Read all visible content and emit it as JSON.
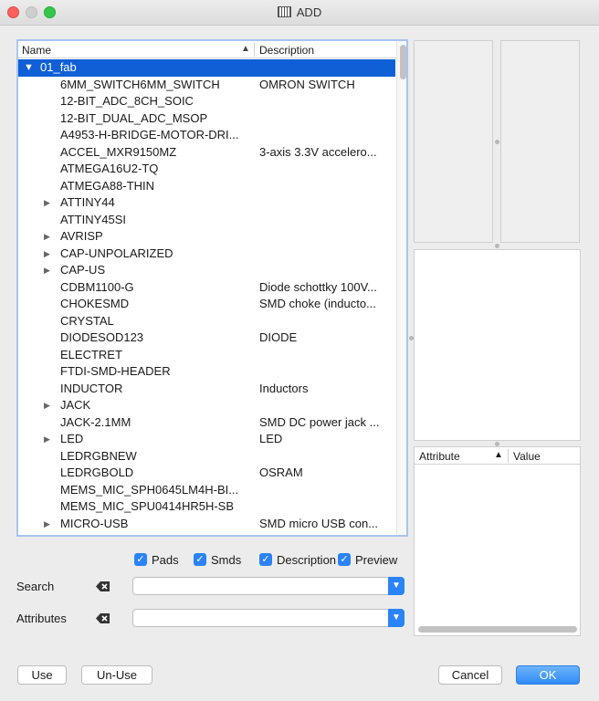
{
  "window": {
    "title": "ADD"
  },
  "tree": {
    "columns": {
      "name": "Name",
      "description": "Description"
    },
    "group": {
      "name": "01_fab"
    },
    "items": [
      {
        "name": "6MM_SWITCH6MM_SWITCH",
        "description": "OMRON SWITCH",
        "expandable": false
      },
      {
        "name": "12-BIT_ADC_8CH_SOIC",
        "description": "",
        "expandable": false
      },
      {
        "name": "12-BIT_DUAL_ADC_MSOP",
        "description": "",
        "expandable": false
      },
      {
        "name": "A4953-H-BRIDGE-MOTOR-DRI...",
        "description": "",
        "expandable": false
      },
      {
        "name": "ACCEL_MXR9150MZ",
        "description": "3-axis 3.3V accelero...",
        "expandable": false
      },
      {
        "name": "ATMEGA16U2-TQ",
        "description": "",
        "expandable": false
      },
      {
        "name": "ATMEGA88-THIN",
        "description": "",
        "expandable": false
      },
      {
        "name": "ATTINY44",
        "description": "",
        "expandable": true
      },
      {
        "name": "ATTINY45SI",
        "description": "",
        "expandable": false
      },
      {
        "name": "AVRISP",
        "description": "",
        "expandable": true
      },
      {
        "name": "CAP-UNPOLARIZED",
        "description": "",
        "expandable": true
      },
      {
        "name": "CAP-US",
        "description": "",
        "expandable": true
      },
      {
        "name": "CDBM1100-G",
        "description": "Diode schottky 100V...",
        "expandable": false
      },
      {
        "name": "CHOKESMD",
        "description": "SMD choke (inducto...",
        "expandable": false
      },
      {
        "name": "CRYSTAL",
        "description": "",
        "expandable": false
      },
      {
        "name": "DIODESOD123",
        "description": "DIODE",
        "expandable": false
      },
      {
        "name": "ELECTRET",
        "description": "",
        "expandable": false
      },
      {
        "name": "FTDI-SMD-HEADER",
        "description": "",
        "expandable": false
      },
      {
        "name": "INDUCTOR",
        "description": "Inductors",
        "expandable": false
      },
      {
        "name": "JACK",
        "description": "",
        "expandable": true
      },
      {
        "name": "JACK-2.1MM",
        "description": "SMD DC power jack ...",
        "expandable": false
      },
      {
        "name": "LED",
        "description": "LED",
        "expandable": true
      },
      {
        "name": "LEDRGBNEW",
        "description": "",
        "expandable": false
      },
      {
        "name": "LEDRGBOLD",
        "description": "OSRAM",
        "expandable": false
      },
      {
        "name": "MEMS_MIC_SPH0645LM4H-BI...",
        "description": "",
        "expandable": false
      },
      {
        "name": "MEMS_MIC_SPU0414HR5H-SB",
        "description": "",
        "expandable": false
      },
      {
        "name": "MICRO-USB",
        "description": "SMD micro USB con...",
        "expandable": true
      }
    ]
  },
  "attributes_table": {
    "col_attribute": "Attribute",
    "col_value": "Value"
  },
  "options": {
    "pads": {
      "label": "Pads",
      "checked": true
    },
    "smds": {
      "label": "Smds",
      "checked": true
    },
    "description": {
      "label": "Description",
      "checked": true
    },
    "preview": {
      "label": "Preview",
      "checked": true
    }
  },
  "search": {
    "label": "Search",
    "value": ""
  },
  "attributes_filter": {
    "label": "Attributes",
    "value": ""
  },
  "buttons": {
    "use": "Use",
    "unuse": "Un-Use",
    "cancel": "Cancel",
    "ok": "OK"
  },
  "icons": {
    "close": "close-dot",
    "minimize": "minimize-dot",
    "maximize": "maximize-dot",
    "sort": "sort-ascending-icon",
    "expand": "disclosure-triangle",
    "clear": "clear-field-icon",
    "dropdown": "chevron-down-icon",
    "check": "checkmark"
  },
  "colors": {
    "accent": "#2a83f7",
    "selection": "#0f5fd7",
    "focus_ring": "#a8c5ee"
  }
}
